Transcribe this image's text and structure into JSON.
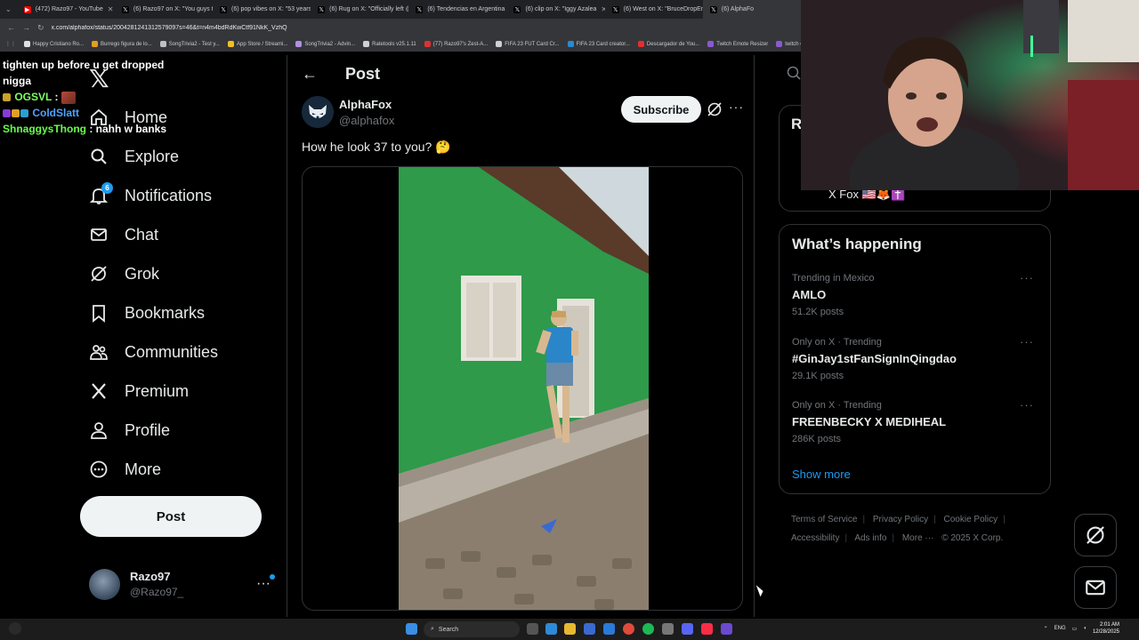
{
  "browser": {
    "tabs": [
      {
        "label": "(472) Razo97 - YouTube",
        "color": "#ff0000"
      },
      {
        "label": "(6) Razo97 on X: \"You guys tal",
        "color": "#000000"
      },
      {
        "label": "(6) pop vibes on X: \"53 years o",
        "color": "#000000"
      },
      {
        "label": "(6) Rug on X: \"Officially left @",
        "color": "#000000"
      },
      {
        "label": "(6) Tendencias en Argentina on",
        "color": "#000000"
      },
      {
        "label": "(6) clip on X: \"Iggy Azalea",
        "color": "#000000"
      },
      {
        "label": "(6) West on X: \"BruceDropEm",
        "color": "#000000"
      },
      {
        "label": "(6) AlphaFo",
        "color": "#000000"
      }
    ],
    "url": "x.com/alphafox/status/2004281241312579097s=46&t=n4m4bdRdKwCtf91NkK_VzhQ",
    "bookmarks": [
      "Happy Cristiano Ro...",
      "Burrego figura de lo...",
      "SongTrivia2 - Test y...",
      "App Store / Streami...",
      "SongTrivia2 - Advin...",
      "Ratetools v25.1.11",
      "(77) Razo97's Zest-A...",
      "FIFA 23 FUT Card Cr...",
      "FIFA 23 Card creator...",
      "Descargador de You...",
      "Twitch Emote Resizer",
      "twitch em"
    ]
  },
  "chat": [
    {
      "user": "",
      "message": "tighten up before u get dropped nigga"
    },
    {
      "user": "OGSVL",
      "message": ""
    },
    {
      "user": "ColdSlatt",
      "message": ""
    },
    {
      "user": "ShnaggysThong",
      "message": "nahh w banks"
    }
  ],
  "nav": {
    "items": [
      {
        "label": "Home",
        "icon": "home-icon"
      },
      {
        "label": "Explore",
        "icon": "search-icon"
      },
      {
        "label": "Notifications",
        "icon": "bell-icon",
        "badge": "6"
      },
      {
        "label": "Chat",
        "icon": "mail-icon"
      },
      {
        "label": "Grok",
        "icon": "grok-icon"
      },
      {
        "label": "Bookmarks",
        "icon": "bookmark-icon"
      },
      {
        "label": "Communities",
        "icon": "people-icon"
      },
      {
        "label": "Premium",
        "icon": "x-icon"
      },
      {
        "label": "Profile",
        "icon": "person-icon"
      },
      {
        "label": "More",
        "icon": "more-circle-icon"
      }
    ],
    "post_button": "Post",
    "account": {
      "name": "Razo97",
      "handle": "@Razo97_"
    }
  },
  "post": {
    "header": "Post",
    "author_name": "AlphaFox",
    "author_handle": "@alphafox",
    "subscribe_label": "Subscribe",
    "text": "How he look 37 to you? 🤔"
  },
  "sidebar": {
    "partial_heading": "R",
    "follow_name": "X Fox 🇺🇸🦊✝️",
    "whats_happening": "What’s happening",
    "trends": [
      {
        "meta": "Trending in Mexico",
        "name": "AMLO",
        "count": "51.2K posts"
      },
      {
        "meta": "Only on X · Trending",
        "name": "#GinJay1stFanSignInQingdao",
        "count": "29.1K posts"
      },
      {
        "meta": "Only on X · Trending",
        "name": "FREENBECKY X MEDIHEAL",
        "count": "286K posts"
      }
    ],
    "show_more": "Show more",
    "footer": [
      "Terms of Service",
      "Privacy Policy",
      "Cookie Policy",
      "Accessibility",
      "Ads info",
      "More ···",
      "© 2025 X Corp."
    ]
  },
  "taskbar": {
    "search": "Search",
    "lang": "ENG",
    "time": "2:01 AM",
    "date": "12/28/2025"
  },
  "colors": {
    "accent": "#1d9bf0",
    "background": "#000000",
    "text": "#e7e9ea",
    "muted": "#71767b"
  }
}
